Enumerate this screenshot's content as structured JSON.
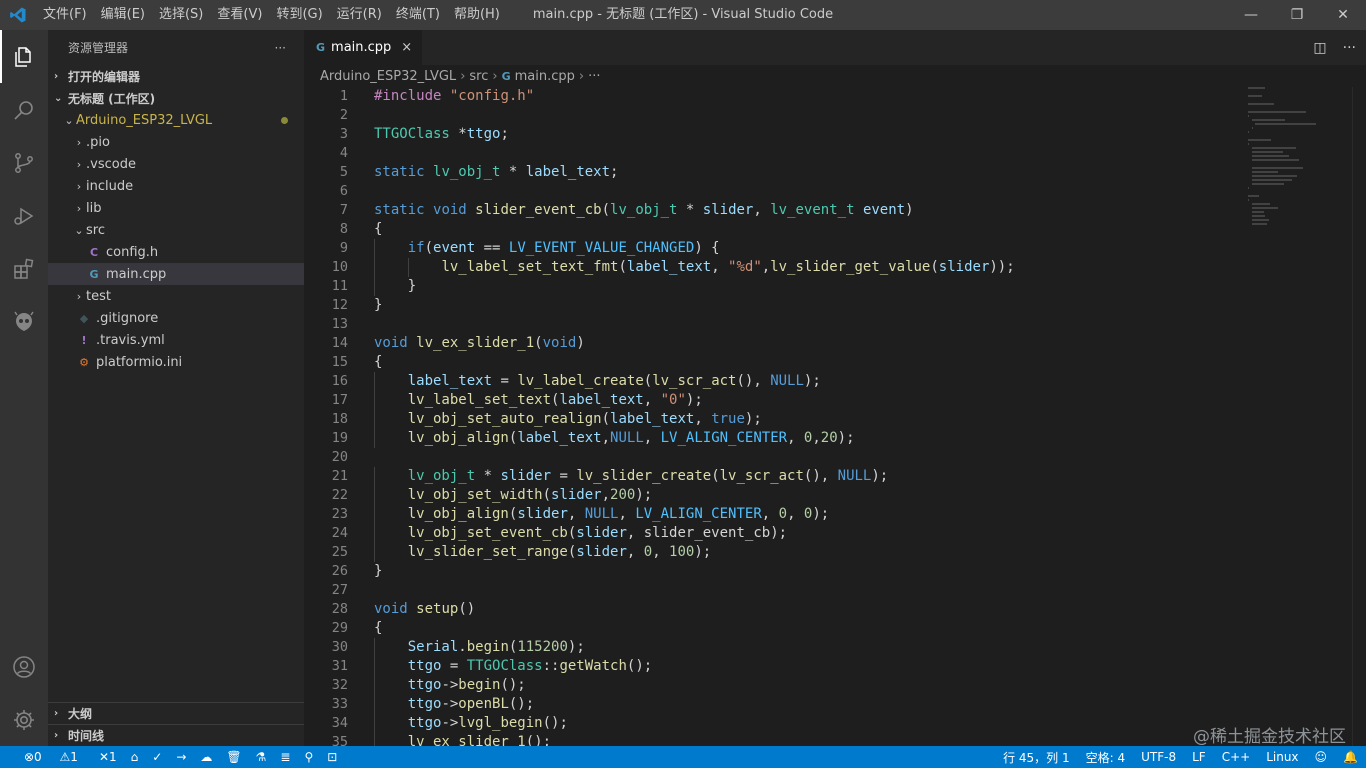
{
  "window": {
    "title": "main.cpp - 无标题 (工作区) - Visual Studio Code",
    "menu": [
      "文件(F)",
      "编辑(E)",
      "选择(S)",
      "查看(V)",
      "转到(G)",
      "运行(R)",
      "终端(T)",
      "帮助(H)"
    ]
  },
  "activity_bar": {
    "items": [
      "files-icon",
      "search-icon",
      "source-control-icon",
      "run-debug-icon",
      "extensions-icon",
      "platformio-icon"
    ],
    "bottom": [
      "account-icon",
      "gear-icon"
    ]
  },
  "sidebar": {
    "title": "资源管理器",
    "more": "···",
    "open_editors": "打开的编辑器",
    "workspace": "无标题 (工作区)",
    "tree": [
      {
        "label": "Arduino_ESP32_LVGL",
        "chev": "⌄",
        "icon": "",
        "indent": 0,
        "color": "#c9b44c"
      },
      {
        "label": ".pio",
        "chev": "›",
        "icon": "",
        "indent": 1
      },
      {
        "label": ".vscode",
        "chev": "›",
        "icon": "",
        "indent": 1
      },
      {
        "label": "include",
        "chev": "›",
        "icon": "",
        "indent": 1
      },
      {
        "label": "lib",
        "chev": "›",
        "icon": "",
        "indent": 1
      },
      {
        "label": "src",
        "chev": "⌄",
        "icon": "",
        "indent": 1
      },
      {
        "label": "config.h",
        "chev": "",
        "icon": "C",
        "iconColor": "#a074c4",
        "indent": 2
      },
      {
        "label": "main.cpp",
        "chev": "",
        "icon": "G",
        "iconColor": "#519aba",
        "indent": 2,
        "selected": true
      },
      {
        "label": "test",
        "chev": "›",
        "icon": "",
        "indent": 1
      },
      {
        "label": ".gitignore",
        "chev": "",
        "icon": "◆",
        "iconColor": "#41535b",
        "indent": 1
      },
      {
        "label": ".travis.yml",
        "chev": "",
        "icon": "!",
        "iconColor": "#a074c4",
        "indent": 1
      },
      {
        "label": "platformio.ini",
        "chev": "",
        "icon": "⚙",
        "iconColor": "#e37933",
        "indent": 1
      }
    ],
    "outline": "大纲",
    "timeline": "时间线"
  },
  "editor": {
    "tab": {
      "label": "main.cpp",
      "close": "×"
    },
    "breadcrumb": [
      "Arduino_ESP32_LVGL",
      "src",
      "main.cpp",
      "···"
    ]
  },
  "code_lines": [
    "#include \"config.h\"",
    "",
    "TTGOClass *ttgo;",
    "",
    "static lv_obj_t * label_text;",
    "",
    "static void slider_event_cb(lv_obj_t * slider, lv_event_t event)",
    "{",
    "    if(event == LV_EVENT_VALUE_CHANGED) {",
    "        lv_label_set_text_fmt(label_text, \"%d\",lv_slider_get_value(slider));",
    "    }",
    "}",
    "",
    "void lv_ex_slider_1(void)",
    "{",
    "    label_text = lv_label_create(lv_scr_act(), NULL);",
    "    lv_label_set_text(label_text, \"0\");",
    "    lv_obj_set_auto_realign(label_text, true);",
    "    lv_obj_align(label_text,NULL, LV_ALIGN_CENTER, 0,20);",
    "",
    "    lv_obj_t * slider = lv_slider_create(lv_scr_act(), NULL);",
    "    lv_obj_set_width(slider,200);",
    "    lv_obj_align(slider, NULL, LV_ALIGN_CENTER, 0, 0);",
    "    lv_obj_set_event_cb(slider, slider_event_cb);",
    "    lv_slider_set_range(slider, 0, 100);",
    "}",
    "",
    "void setup()",
    "{",
    "    Serial.begin(115200);",
    "    ttgo = TTGOClass::getWatch();",
    "    ttgo->begin();",
    "    ttgo->openBL();",
    "    ttgo->lvgl_begin();",
    "    lv_ex_slider_1();"
  ],
  "statusbar": {
    "errors": "⊗0",
    "warnings": "⚠1",
    "tools": "✕1",
    "left_icons": [
      "home-icon",
      "check-icon",
      "arrow-right-icon",
      "upload-icon",
      "trash-icon",
      "flask-icon",
      "list-icon",
      "plug-icon",
      "terminal-icon"
    ],
    "position": "行 45，列 1",
    "spaces": "空格: 4",
    "encoding": "UTF-8",
    "eol": "LF",
    "language": "C++",
    "platform": "Linux"
  },
  "watermark": "@稀土掘金技术社区"
}
